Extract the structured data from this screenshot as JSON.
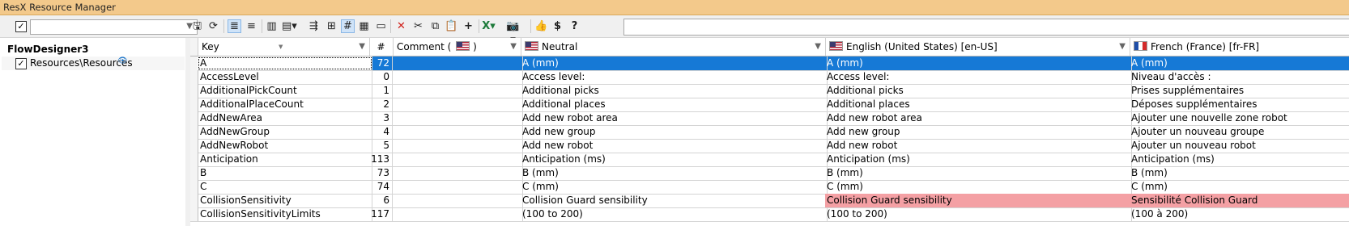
{
  "window": {
    "title": "ResX Resource Manager"
  },
  "toolbar": {
    "filter_value": "",
    "search_value": "",
    "icons": [
      "save-icon",
      "refresh-icon",
      "align-left-icon",
      "align-center-icon",
      "columns-icon",
      "columns-menu-icon",
      "import-icon",
      "tree-icon",
      "number-icon",
      "grid-icon",
      "comment-icon",
      "delete-icon",
      "cut-icon",
      "copy-icon",
      "paste-icon",
      "add-icon",
      "excel-icon",
      "camera-icon",
      "like-icon",
      "donate-icon",
      "help-icon"
    ]
  },
  "tree": {
    "project": "FlowDesigner3",
    "items": [
      {
        "label": "Resources\\Resources",
        "checked": true
      }
    ]
  },
  "grid": {
    "columns": {
      "key": "Key",
      "num": "#",
      "comment": "Comment (",
      "comment_tail": ")",
      "neutral": "Neutral",
      "english": "English (United States) [en-US]",
      "french": "French (France) [fr-FR]"
    },
    "rows": [
      {
        "key": "A",
        "num": "72",
        "comment": "",
        "neutral": "A (mm)",
        "en": "A (mm)",
        "fr": "A (mm)",
        "selected": true
      },
      {
        "key": "AccessLevel",
        "num": "0",
        "comment": "",
        "neutral": "Access level:",
        "en": "Access level:",
        "fr": "Niveau d'accès :"
      },
      {
        "key": "AdditionalPickCount",
        "num": "1",
        "comment": "",
        "neutral": "Additional picks",
        "en": "Additional picks",
        "fr": "Prises supplémentaires"
      },
      {
        "key": "AdditionalPlaceCount",
        "num": "2",
        "comment": "",
        "neutral": "Additional places",
        "en": "Additional places",
        "fr": "Déposes supplémentaires"
      },
      {
        "key": "AddNewArea",
        "num": "3",
        "comment": "",
        "neutral": "Add new robot area",
        "en": "Add new robot area",
        "fr": "Ajouter une nouvelle zone robot"
      },
      {
        "key": "AddNewGroup",
        "num": "4",
        "comment": "",
        "neutral": "Add new group",
        "en": "Add new group",
        "fr": "Ajouter un nouveau groupe"
      },
      {
        "key": "AddNewRobot",
        "num": "5",
        "comment": "",
        "neutral": "Add new robot",
        "en": "Add new robot",
        "fr": "Ajouter un nouveau robot"
      },
      {
        "key": "Anticipation",
        "num": "113",
        "comment": "",
        "neutral": "Anticipation (ms)",
        "en": "Anticipation (ms)",
        "fr": "Anticipation (ms)"
      },
      {
        "key": "B",
        "num": "73",
        "comment": "",
        "neutral": "B (mm)",
        "en": "B (mm)",
        "fr": "B (mm)"
      },
      {
        "key": "C",
        "num": "74",
        "comment": "",
        "neutral": "C (mm)",
        "en": "C (mm)",
        "fr": "C (mm)"
      },
      {
        "key": "CollisionSensitivity",
        "num": "6",
        "comment": "",
        "neutral": "Collision Guard sensibility",
        "en": "Collision Guard sensibility",
        "fr": "Sensibilité Collision Guard",
        "highlight": true
      },
      {
        "key": "CollisionSensitivityLimits",
        "num": "117",
        "comment": "",
        "neutral": "(100 to 200)",
        "en": "(100 to 200)",
        "fr": "(100 à 200)"
      }
    ]
  },
  "colors": {
    "titlebar": "#f3c98b",
    "selection": "#1679d6",
    "highlight": "#f4a0a4"
  }
}
